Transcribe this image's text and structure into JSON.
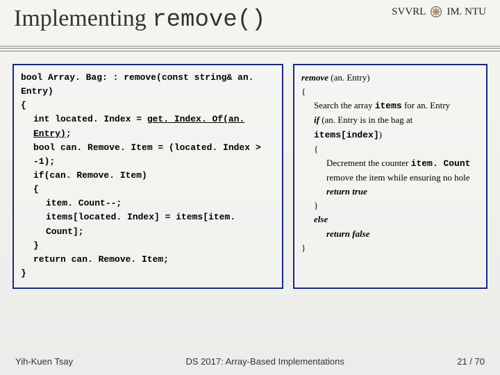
{
  "header": {
    "title_plain": "Implementing ",
    "title_mono": "remove()",
    "right_left": "SVVRL",
    "right_at": "@",
    "right_right": "IM. NTU"
  },
  "code": {
    "l1a": "bool Array. Bag: : remove(const string& an. Entry)",
    "l2": "{",
    "l3a": "int located. Index = ",
    "l3u": "get. Index. Of(an. Entry)",
    "l3b": ";",
    "l4": "bool can. Remove. Item = (located. Index > -1);",
    "l5": "if(can. Remove. Item)",
    "l6": "{",
    "l7": "item. Count--;",
    "l8": "items[located. Index] = items[item. Count];",
    "l9": "}",
    "l10": "return can. Remove. Item;",
    "l11": "}"
  },
  "pseudo": {
    "p1a": "remove",
    "p1b": " (an. Entry)",
    "p2": "{",
    "p3a": "Search the array ",
    "p3m": "items",
    "p3b": " for an. Entry",
    "p4a": "if",
    "p4b": " (an. Entry is in the bag at ",
    "p4m": "items[index]",
    "p4c": ")",
    "p5": "{",
    "p6a": "Decrement the counter ",
    "p6m": "item. Count",
    "p7": "remove the item while ensuring no hole",
    "p8": "return true",
    "p9": "}",
    "p10": "else",
    "p11": "return false",
    "p12": "}"
  },
  "footer": {
    "left": "Yih-Kuen Tsay",
    "center": "DS 2017: Array-Based Implementations",
    "right": "21 / 70"
  }
}
